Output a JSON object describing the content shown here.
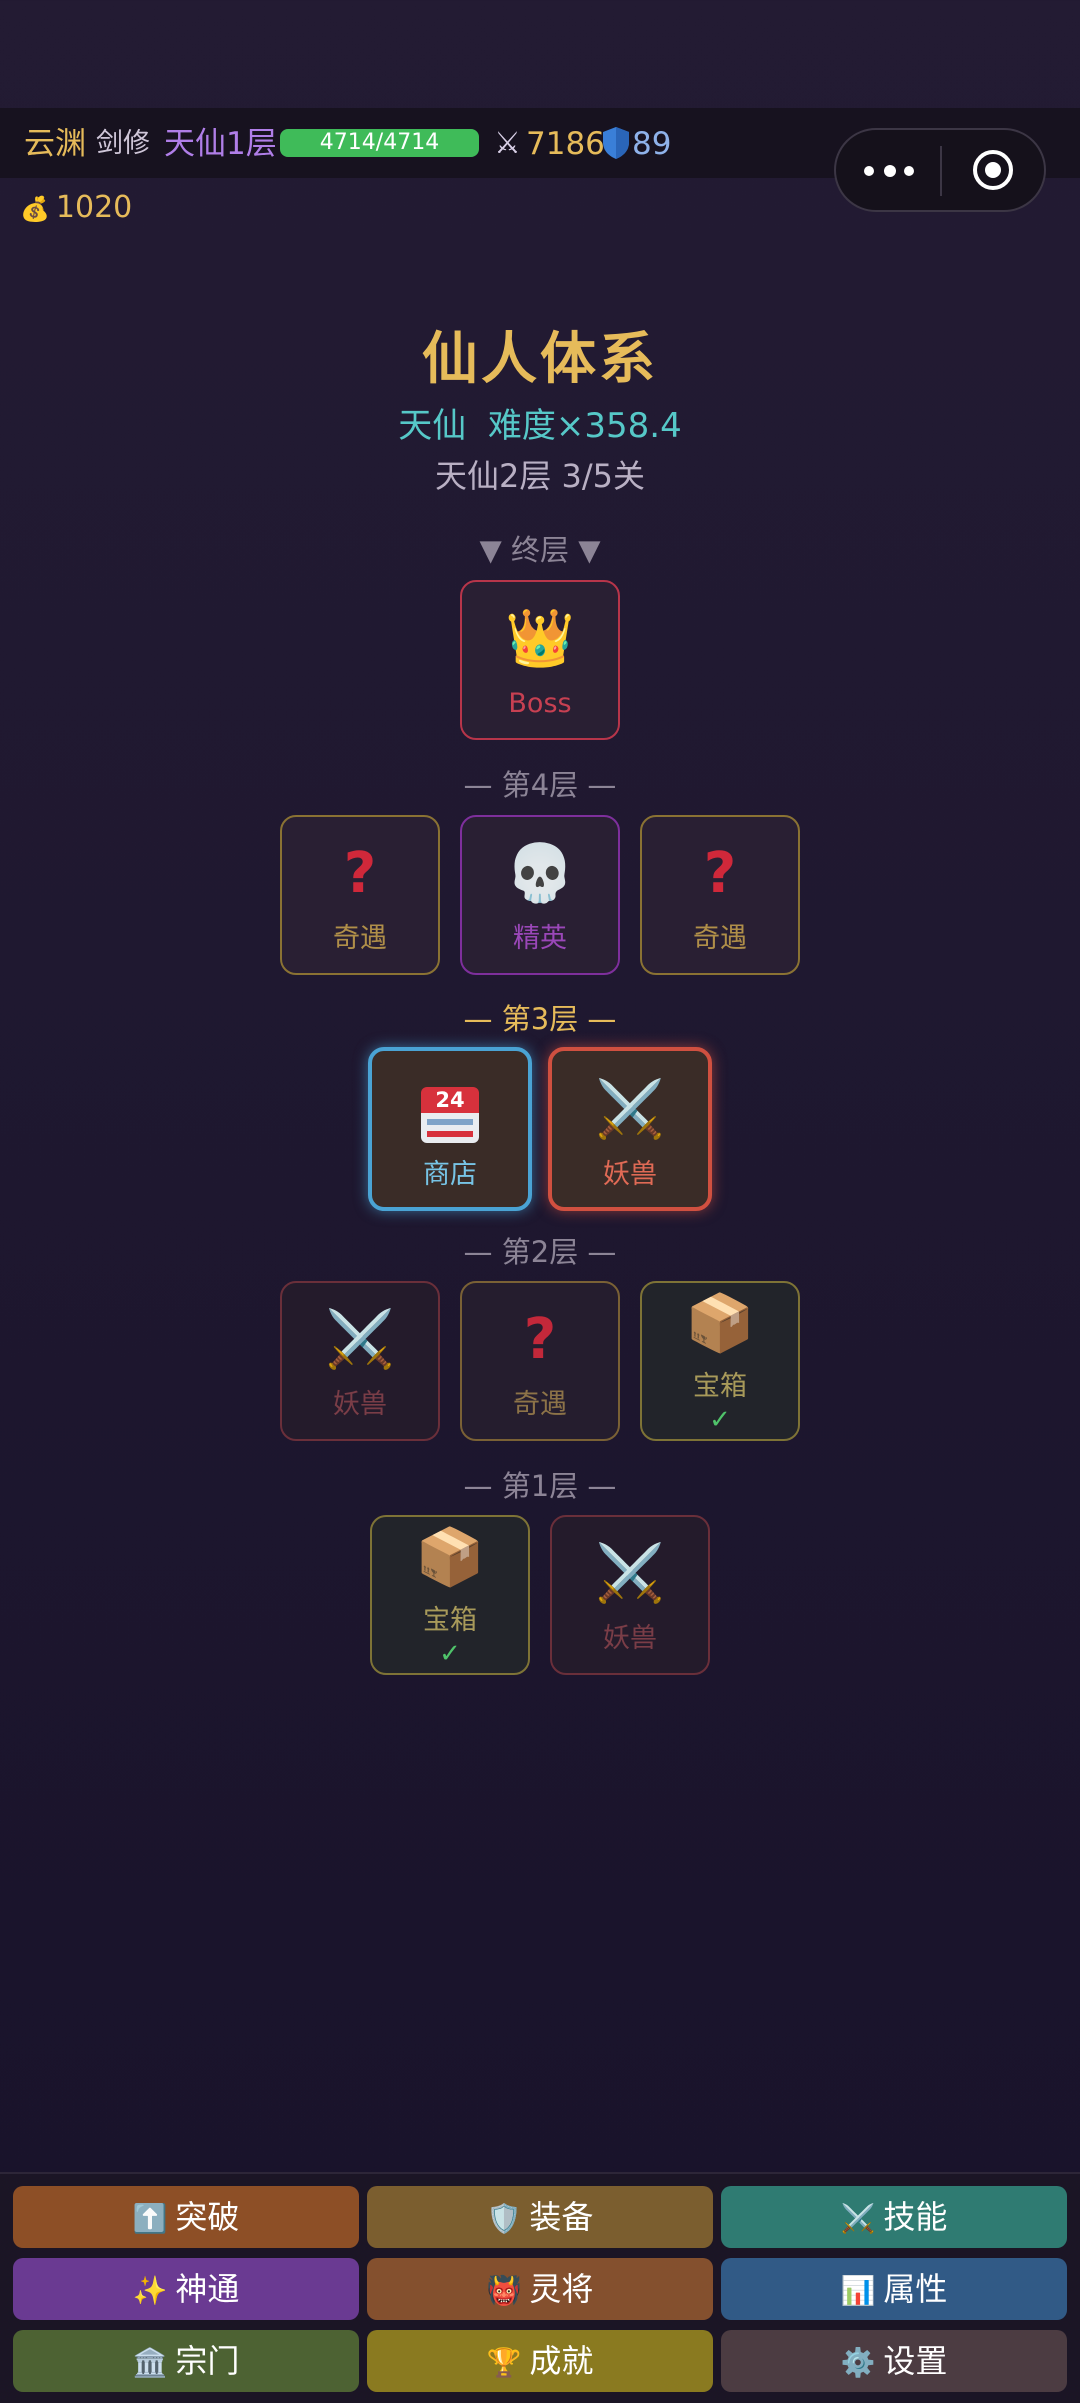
{
  "status": {
    "name": "云渊",
    "class": "剑修",
    "realm": "天仙1层",
    "hp": "4714/4714",
    "hp_fraction": 1.0,
    "attack": "7186",
    "defense": "89",
    "gold": "1020"
  },
  "header": {
    "title": "仙人体系",
    "subtitle": "天仙  难度×358.4",
    "progress": "天仙2层 3/5关"
  },
  "map": {
    "final_label": "▼ 终层 ▼",
    "layer4_label": "— 第4层 —",
    "layer3_label": "— 第3层 —",
    "layer2_label": "— 第2层 —",
    "layer1_label": "— 第1层 —",
    "boss": "Boss",
    "event": "奇遇",
    "elite": "精英",
    "shop": "商店",
    "shop_calendar": "24",
    "beast": "妖兽",
    "chest": "宝箱",
    "check": "✓"
  },
  "nav": {
    "breakthrough": "突破",
    "equipment": "装备",
    "skills": "技能",
    "powers": "神通",
    "generals": "灵将",
    "attributes": "属性",
    "sect": "宗门",
    "achievements": "成就",
    "settings": "设置"
  },
  "colors": {
    "accent_gold": "#e6bb5a",
    "teal": "#56c8c8",
    "hp_green": "#3fbb59"
  }
}
